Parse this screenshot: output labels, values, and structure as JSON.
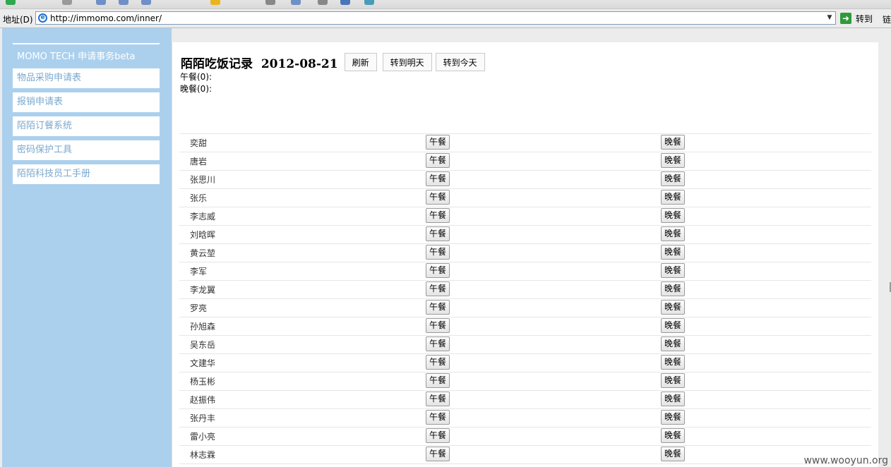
{
  "browser": {
    "address_label": "地址(D)",
    "url": "http://immomo.com/inner/",
    "go_label": "转到",
    "links_label": "链"
  },
  "sidebar": {
    "title": "MOMO TECH 申请事务beta",
    "items": [
      {
        "label": "物品采购申请表"
      },
      {
        "label": "报销申请表"
      },
      {
        "label": "陌陌订餐系统"
      },
      {
        "label": "密码保护工具"
      },
      {
        "label": "陌陌科技员工手册"
      }
    ]
  },
  "main": {
    "title": "陌陌吃饭记录",
    "date": "2012-08-21",
    "buttons": {
      "refresh": "刷新",
      "tomorrow": "转到明天",
      "today": "转到今天"
    },
    "lunch_count": "午餐(0):",
    "dinner_count": "晚餐(0):",
    "lunch_label": "午餐",
    "dinner_label": "晚餐",
    "people": [
      "奕甜",
      "唐岩",
      "张思川",
      "张乐",
      "李志威",
      "刘晗晖",
      "黄云堃",
      "李军",
      "李龙翼",
      "罗亮",
      "孙旭森",
      "吴东岳",
      "文建华",
      "杨玉彬",
      "赵振伟",
      "张丹丰",
      "雷小亮",
      "林志霖"
    ]
  },
  "watermark": "www.wooyun.org",
  "colors": {
    "sidebar_bg": "#abd0ee",
    "sidebar_link": "#7aa8cf",
    "go_green": "#2e9b3a"
  }
}
